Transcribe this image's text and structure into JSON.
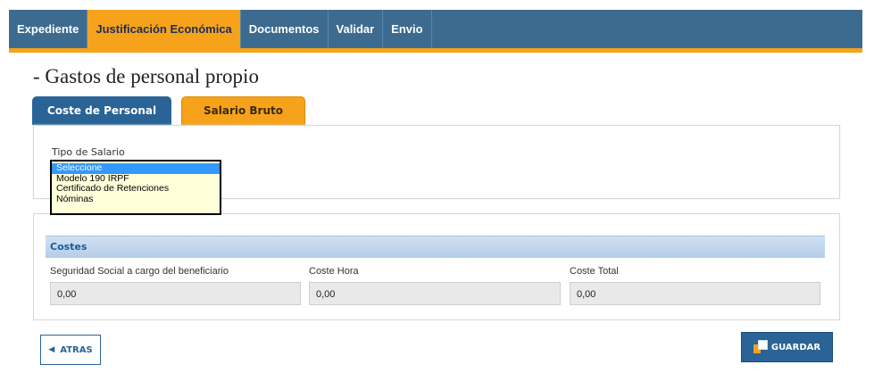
{
  "nav": {
    "tabs": [
      {
        "label": "Expediente"
      },
      {
        "label": "Justificación Económica"
      },
      {
        "label": "Documentos"
      },
      {
        "label": "Validar"
      },
      {
        "label": "Envio"
      }
    ],
    "active_index": 1
  },
  "page": {
    "title": "- Gastos de personal propio"
  },
  "subtabs": {
    "coste": "Coste de Personal",
    "bruto": "Salario Bruto"
  },
  "salario": {
    "label": "Tipo de Salario",
    "options": [
      "Seleccione",
      "Modelo 190 IRPF",
      "Certificado de Retenciones",
      "Nóminas"
    ],
    "selected_index": 0
  },
  "costes": {
    "header": "Costes",
    "fields": [
      {
        "label": "Seguridad Social a cargo del beneficiario",
        "value": "0,00"
      },
      {
        "label": "Coste Hora",
        "value": "0,00"
      },
      {
        "label": "Coste Total",
        "value": "0,00"
      }
    ]
  },
  "buttons": {
    "atras": "ATRAS",
    "guardar": "GUARDAR",
    "atras_icon": "chevron-left-icon",
    "guardar_icon": "save-icon"
  },
  "colors": {
    "nav_bg": "#3d6b90",
    "accent": "#f7a21b",
    "primary": "#2a6396"
  }
}
